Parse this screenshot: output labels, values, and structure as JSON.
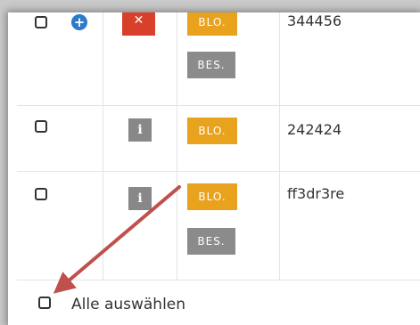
{
  "rows": [
    {
      "checkbox_checked": false,
      "has_add_icon": true,
      "action_icon": "close-icon",
      "action_label": "✕",
      "tags": [
        "BLO.",
        "BES."
      ],
      "value": "344456"
    },
    {
      "checkbox_checked": false,
      "has_add_icon": false,
      "action_icon": "info-icon",
      "action_label": "i",
      "tags": [
        "BLO."
      ],
      "value": "242424"
    },
    {
      "checkbox_checked": false,
      "has_add_icon": false,
      "action_icon": "info-icon",
      "action_label": "i",
      "tags": [
        "BLO.",
        "BES."
      ],
      "value": "ff3dr3re"
    }
  ],
  "footer": {
    "select_all_label": "Alle auswählen"
  },
  "icons": {
    "add": "+",
    "add_icon_name": "plus-circle-icon"
  },
  "colors": {
    "blo_tag": "#e8a21d",
    "bes_tag": "#8b8b8b",
    "delete_button": "#d9402b",
    "info_button": "#888888",
    "add_icon": "#2b7bc8",
    "annotation_arrow": "#c0504d"
  }
}
